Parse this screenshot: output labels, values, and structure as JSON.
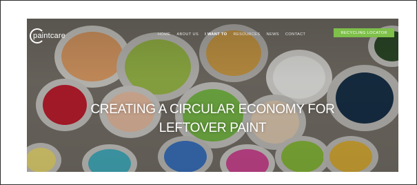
{
  "header": {
    "logo_text": "paintcare",
    "nav": [
      {
        "label": "HOME"
      },
      {
        "label": "ABOUT US"
      },
      {
        "label": "I WANT TO"
      },
      {
        "label": "RESOURCES"
      },
      {
        "label": "NEWS"
      },
      {
        "label": "CONTACT"
      }
    ],
    "cta_label": "RECYCLING LOCATOR"
  },
  "hero": {
    "headline_line1": "CREATING A CIRCULAR ECONOMY FOR",
    "headline_line2": "LEFTOVER PAINT"
  },
  "colors": {
    "cta_green": "#7ec04a",
    "frame_border": "#2b2b2b",
    "text": "#ffffff"
  },
  "icons": [
    "logo-ring-icon"
  ]
}
